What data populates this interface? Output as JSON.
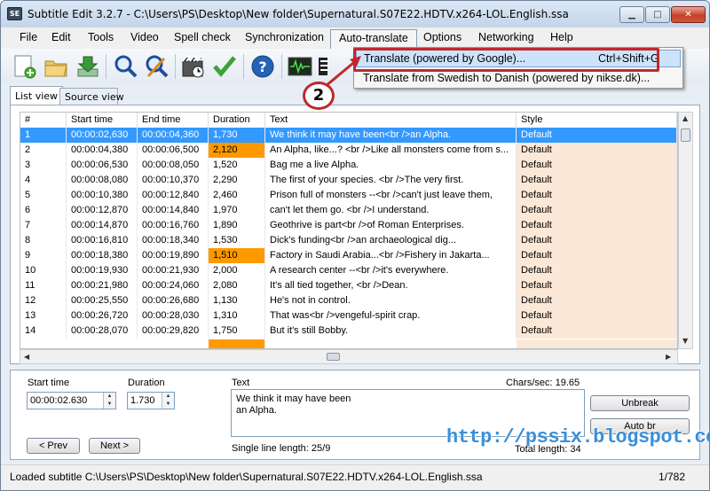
{
  "window": {
    "app_icon_text": "SE",
    "title": "Subtitle Edit 3.2.7 - C:\\Users\\PS\\Desktop\\New folder\\Supernatural.S07E22.HDTV.x264-LOL.English.ssa",
    "controls": {
      "minimize": "▁",
      "maximize": "□",
      "close": "✕"
    }
  },
  "menu": [
    "File",
    "Edit",
    "Tools",
    "Video",
    "Spell check",
    "Synchronization",
    "Auto-translate",
    "Options",
    "Networking",
    "Help"
  ],
  "toolbar": {
    "icons": [
      "new-file-icon",
      "open-folder-icon",
      "save-icon",
      "find-icon",
      "replace-icon",
      "visual-sync-icon",
      "spell-check-icon",
      "help-icon",
      "waveform-icon",
      "video-icon"
    ]
  },
  "dropdown": {
    "item1": {
      "label": "Translate (powered by Google)...",
      "shortcut": "Ctrl+Shift+G"
    },
    "item2": {
      "label": "Translate from Swedish to Danish (powered by nikse.dk)..."
    }
  },
  "callout": "2",
  "tabs": [
    "List view",
    "Source view"
  ],
  "grid": {
    "columns": [
      "#",
      "Start time",
      "End time",
      "Duration",
      "Text",
      "Style"
    ],
    "rows": [
      {
        "n": "1",
        "start": "00:00:02,630",
        "end": "00:00:04,360",
        "dur": "1,730",
        "text": "We think it may have been<br />an Alpha.",
        "style": "Default"
      },
      {
        "n": "2",
        "start": "00:00:04,380",
        "end": "00:00:06,500",
        "dur": "2,120",
        "text": "An Alpha, like...? <br />Like all monsters come from s...",
        "style": "Default"
      },
      {
        "n": "3",
        "start": "00:00:06,530",
        "end": "00:00:08,050",
        "dur": "1,520",
        "text": "Bag me a live Alpha.",
        "style": "Default"
      },
      {
        "n": "4",
        "start": "00:00:08,080",
        "end": "00:00:10,370",
        "dur": "2,290",
        "text": "The first of your species. <br />The very first.",
        "style": "Default"
      },
      {
        "n": "5",
        "start": "00:00:10,380",
        "end": "00:00:12,840",
        "dur": "2,460",
        "text": "Prison full of monsters --<br />can't just leave them,",
        "style": "Default"
      },
      {
        "n": "6",
        "start": "00:00:12,870",
        "end": "00:00:14,840",
        "dur": "1,970",
        "text": "can't let them go. <br />I understand.",
        "style": "Default"
      },
      {
        "n": "7",
        "start": "00:00:14,870",
        "end": "00:00:16,760",
        "dur": "1,890",
        "text": "Geothrive is part<br />of Roman Enterprises.",
        "style": "Default"
      },
      {
        "n": "8",
        "start": "00:00:16,810",
        "end": "00:00:18,340",
        "dur": "1,530",
        "text": "Dick's funding<br />an archaeological dig...",
        "style": "Default"
      },
      {
        "n": "9",
        "start": "00:00:18,380",
        "end": "00:00:19,890",
        "dur": "1,510",
        "text": "Factory in Saudi Arabia...<br />Fishery in Jakarta...",
        "style": "Default"
      },
      {
        "n": "10",
        "start": "00:00:19,930",
        "end": "00:00:21,930",
        "dur": "2,000",
        "text": "A research center --<br />it's everywhere.",
        "style": "Default"
      },
      {
        "n": "11",
        "start": "00:00:21,980",
        "end": "00:00:24,060",
        "dur": "2,080",
        "text": "It's all tied together, <br />Dean.",
        "style": "Default"
      },
      {
        "n": "12",
        "start": "00:00:25,550",
        "end": "00:00:26,680",
        "dur": "1,130",
        "text": "He's not in control.",
        "style": "Default"
      },
      {
        "n": "13",
        "start": "00:00:26,720",
        "end": "00:00:28,030",
        "dur": "1,310",
        "text": "That was<br />vengeful-spirit crap.",
        "style": "Default"
      },
      {
        "n": "14",
        "start": "00:00:28,070",
        "end": "00:00:29,820",
        "dur": "1,750",
        "text": "But it's still Bobby.",
        "style": "Default"
      }
    ]
  },
  "editor": {
    "start_label": "Start time",
    "start_value": "00:00:02.630",
    "duration_label": "Duration",
    "duration_value": "1.730",
    "text_label": "Text",
    "chars_per_sec": "Chars/sec: 19.65",
    "text_line1": "We think it may have been",
    "text_line2": "an Alpha.",
    "single_line_length": "Single line length: 25/9",
    "total_length": "Total length: 34",
    "prev_button": "< Prev",
    "next_button": "Next >",
    "unbreak_button": "Unbreak",
    "autobr_button": "Auto br"
  },
  "watermark": "http://pssix.blogspot.com",
  "status": {
    "message": "Loaded subtitle C:\\Users\\PS\\Desktop\\New folder\\Supernatural.S07E22.HDTV.x264-LOL.English.ssa",
    "position": "1/782"
  },
  "colors": {
    "selection": "#3399ff",
    "warning": "#ff9900",
    "style_cell": "#fbe8d6",
    "highlight_border": "#c0282c",
    "watermark": "#3a8fd9"
  }
}
